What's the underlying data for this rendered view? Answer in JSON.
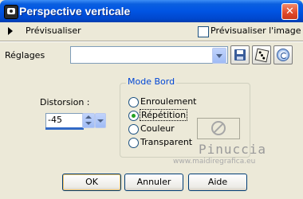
{
  "window": {
    "title": "Perspective verticale",
    "close_label": "✕"
  },
  "preview": {
    "label": "Prévisualiser",
    "image_preview_label": "Prévisualiser l'image",
    "image_preview_checked": false
  },
  "presets": {
    "label": "Réglages",
    "value": ""
  },
  "distortion": {
    "label": "Distorsion :",
    "value": "-45"
  },
  "edge_mode": {
    "title": "Mode Bord",
    "options": [
      {
        "label": "Enroulement",
        "checked": false
      },
      {
        "label": "Répétition",
        "checked": true
      },
      {
        "label": "Couleur",
        "checked": false
      },
      {
        "label": "Transparent",
        "checked": false
      }
    ]
  },
  "watermark": {
    "name": "Pinuccia",
    "url": "www.maidiregrafica.eu"
  },
  "buttons": {
    "ok": "OK",
    "cancel": "Annuler",
    "help": "Aide"
  },
  "colors": {
    "title_bar": "#0054e3",
    "group_title": "#0046d5",
    "radio_dot": "#21a121",
    "dialog_bg": "#ece9d8"
  }
}
